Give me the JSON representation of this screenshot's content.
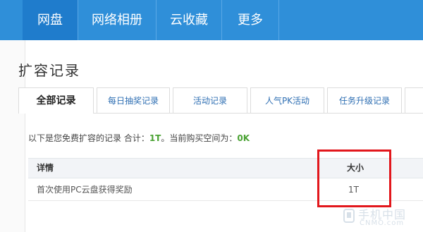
{
  "nav": {
    "items": [
      {
        "label": "网盘",
        "active": true
      },
      {
        "label": "网络相册",
        "active": false
      },
      {
        "label": "云收藏",
        "active": false
      },
      {
        "label": "更多",
        "active": false
      }
    ]
  },
  "page": {
    "title": "扩容记录"
  },
  "tabs": [
    {
      "label": "全部记录",
      "active": true
    },
    {
      "label": "每日抽奖记录",
      "active": false
    },
    {
      "label": "活动记录",
      "active": false
    },
    {
      "label": "人气PK活动",
      "active": false
    },
    {
      "label": "任务升级记录",
      "active": false
    }
  ],
  "summary": {
    "prefix": "以下是您免费扩容的记录 合计：",
    "total": "1T",
    "middle": "。当前购买空间为：",
    "purchased": "0K"
  },
  "table": {
    "headers": {
      "detail": "详情",
      "size": "大小"
    },
    "rows": [
      {
        "detail": "首次使用PC云盘获得奖励",
        "size": "1T"
      }
    ]
  },
  "watermark": {
    "cn": "手机中国",
    "en": "CNMO.com"
  },
  "colors": {
    "nav_bg": "#2f8fd9",
    "nav_active": "#1f7ccc",
    "highlight": "#e2171c",
    "green": "#4aa233"
  }
}
